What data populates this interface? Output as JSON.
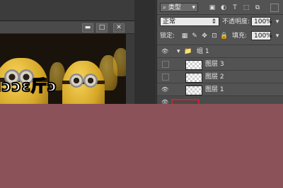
{
  "document_window": {
    "buttons": [
      "▬",
      "□",
      "✕"
    ],
    "meme_text": "ıɔɔɛ⽄ɔ"
  },
  "layers_panel": {
    "filter": {
      "icon": "search-icon",
      "label": "类型",
      "dropdown_icon": "chevron-down-icon"
    },
    "blend_mode": "正常",
    "opacity_label": "不透明度:",
    "opacity_value": "100%",
    "lock_label": "锁定:",
    "fill_label": "填充:",
    "fill_value": "100%",
    "group": {
      "name": "组 1",
      "expanded": true,
      "visible": true
    },
    "layers": [
      {
        "name": "图层 3",
        "visible": false
      },
      {
        "name": "图层 2",
        "visible": false
      },
      {
        "name": "图层 1",
        "visible": true
      }
    ],
    "colors": {
      "selection_highlight": "#d5202c",
      "background": "#8b525a"
    }
  }
}
